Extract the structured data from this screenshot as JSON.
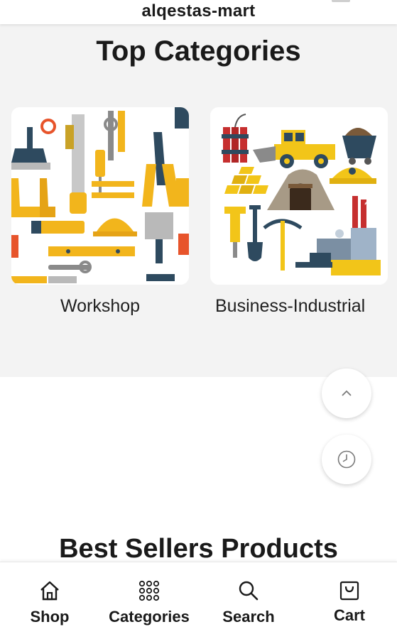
{
  "header": {
    "title": "alqestas-mart"
  },
  "top_categories": {
    "title": "Top Categories",
    "items": [
      {
        "label": "Workshop",
        "image_icon": "tools-illustration"
      },
      {
        "label": "Business-Industrial",
        "image_icon": "mining-industry-illustration"
      }
    ]
  },
  "floating_buttons": [
    {
      "icon": "chevron-up-icon"
    },
    {
      "icon": "history-clock-icon"
    }
  ],
  "best_sellers": {
    "title": "Best Sellers Products"
  },
  "bottom_nav": {
    "items": [
      {
        "label": "Shop",
        "icon": "home-icon"
      },
      {
        "label": "Categories",
        "icon": "grid-dots-icon"
      },
      {
        "label": "Search",
        "icon": "search-icon"
      },
      {
        "label": "Cart",
        "icon": "shopping-bag-icon"
      }
    ]
  },
  "colors": {
    "accent_yellow": "#f2b51c",
    "dark_slate": "#2e4a5f",
    "text": "#1a1a1a",
    "section_bg": "#f3f3f3"
  }
}
